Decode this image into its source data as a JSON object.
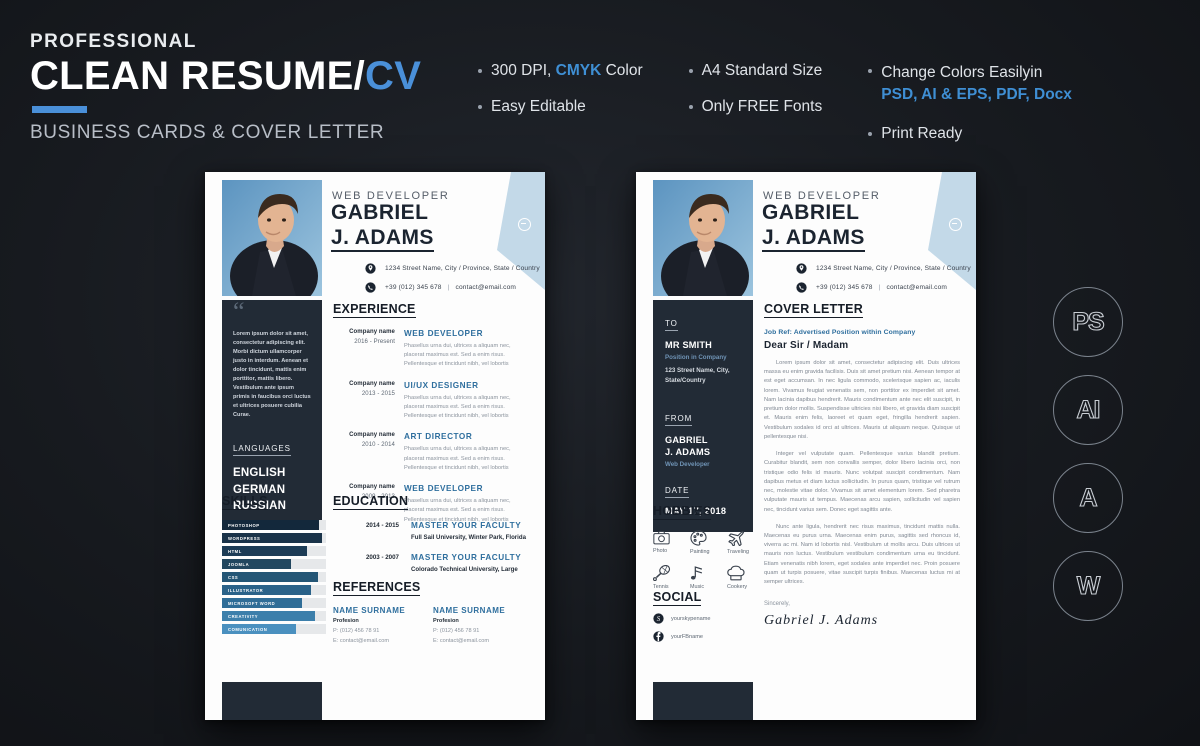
{
  "header": {
    "eyebrow": "PROFESSIONAL",
    "title_main": "CLEAN RESUME/",
    "title_accent": "CV",
    "subtitle": "BUSINESS CARDS & COVER LETTER"
  },
  "features": {
    "col1": [
      {
        "pre": "300 DPI, ",
        "strong": "CMYK",
        "post": " Color"
      },
      {
        "pre": "Easy Editable",
        "strong": "",
        "post": ""
      }
    ],
    "col2": [
      {
        "pre": "A4 Standard Size",
        "strong": "",
        "post": ""
      },
      {
        "pre": "Only FREE Fonts",
        "strong": "",
        "post": ""
      }
    ],
    "col3": [
      {
        "line1": "Change Colors Easilyin",
        "line2": "PSD, AI & EPS, PDF, Docx"
      },
      {
        "line1": "Print Ready",
        "line2": ""
      }
    ]
  },
  "colors": {
    "accent_blue": "#4a90d9",
    "dark_navy": "#222b36",
    "page_bg": "#fdfdfd",
    "light_blue": "#c3d9e8",
    "title_blue": "#2f6f9e"
  },
  "resume": {
    "role": "WEB DEVELOPER",
    "name_line1": "GABRIEL",
    "name_line2": "J. ADAMS",
    "address": "1234 Street Name, City / Province, State / Country",
    "phone": "+39 (012) 345 678",
    "email": "contact@email.com",
    "profile_text": "Lorem ipsum dolor sit amet, consectetur adipiscing elit. Morbi dictum ullamcorper justo in interdum. Aenean et dolor tincidunt, mattis enim porttitor, mattis libero. Vestibulum ante ipsum primis in faucibus orci luctus et ultrices posuere cubilia Curae.",
    "languages_heading": "LANGUAGES",
    "languages": [
      "ENGLISH",
      "GERMAN",
      "RUSSIAN"
    ],
    "experience_heading": "EXPERIENCE",
    "experience": [
      {
        "company": "Company name",
        "years": "2016 - Present",
        "title": "WEB DEVELOPER",
        "desc": "Phasellus urna dui, ultrices a aliquam nec, placerat maximus est. Sed a enim risus. Pellentesque et tincidunt nibh, vel lobortis"
      },
      {
        "company": "Company name",
        "years": "2013 - 2015",
        "title": "UI/UX DESIGNER",
        "desc": "Phasellus urna dui, ultrices a aliquam nec, placerat maximus est. Sed a enim risus. Pellentesque et tincidunt nibh, vel lobortis"
      },
      {
        "company": "Company name",
        "years": "2010 - 2014",
        "title": "ART DIRECTOR",
        "desc": "Phasellus urna dui, ultrices a aliquam nec, placerat maximus est. Sed a enim risus. Pellentesque et tincidunt nibh, vel lobortis"
      },
      {
        "company": "Company name",
        "years": "2009 - 2013",
        "title": "WEB DEVELOPER",
        "desc": "Phasellus urna dui, ultrices a aliquam nec, placerat maximus est. Sed a enim risus. Pellentesque et tincidunt nibh, vel lobortis"
      }
    ],
    "skills_heading": "SKILLS",
    "skills": [
      {
        "label": "PHOTOSHOP",
        "value": 93,
        "color": "#13283b"
      },
      {
        "label": "WORDPRESS",
        "value": 96,
        "color": "#1a3349"
      },
      {
        "label": "HTML",
        "value": 82,
        "color": "#1d3c56"
      },
      {
        "label": "JOOMLA",
        "value": 66,
        "color": "#22475f"
      },
      {
        "label": "CSS",
        "value": 92,
        "color": "#245676"
      },
      {
        "label": "ILLUSTRATOR",
        "value": 86,
        "color": "#2a6289"
      },
      {
        "label": "MICROSOFT WORD",
        "value": 77,
        "color": "#2f6d97"
      },
      {
        "label": "CREATIVITY",
        "value": 89,
        "color": "#3c7fab"
      },
      {
        "label": "COMUNICATION",
        "value": 71,
        "color": "#4a90bf"
      }
    ],
    "education_heading": "EDUCATION",
    "education": [
      {
        "years": "2014 - 2015",
        "title": "MASTER YOUR FACULTY",
        "school": "Full Sail University, Winter Park, Florida"
      },
      {
        "years": "2003 - 2007",
        "title": "MASTER YOUR FACULTY",
        "school": "Colorado Technical University, Large"
      }
    ],
    "references_heading": "REFERENCES",
    "references": [
      {
        "name": "NAME SURNAME",
        "profession": "Profesion",
        "phone": "P: (012) 456 78 91",
        "email": "E: contact@email.com"
      },
      {
        "name": "NAME SURNAME",
        "profession": "Profesion",
        "phone": "P: (012) 456 78 91",
        "email": "E: contact@email.com"
      }
    ]
  },
  "cover": {
    "to_heading": "TO",
    "to_name": "MR SMITH",
    "to_role": "Position in Company",
    "to_address": "123 Street Name, City, State/Country",
    "from_heading": "FROM",
    "from_name_1": "GABRIEL",
    "from_name_2": "J. ADAMS",
    "from_role": "Web Developer",
    "date_heading": "DATE",
    "date_value": "MAY 17, 2018",
    "heading": "COVER LETTER",
    "job_ref": "Job Ref: Advertised Position within Company",
    "salutation": "Dear Sir / Madam",
    "paragraphs": [
      "Lorem ipsum dolor sit amet, consectetur adipiscing elit. Duis ultrices massa eu enim gravida facilisis. Duis sit amet pretium nisi. Aenean tempor at est eget accumsan. In nec ligula commodo, scelerisque sapien ac, iaculis lorem. Vivamus feugiat venenatis sem, non porttitor ex imperdiet sit amet. Nam lacinia dapibus hendrerit. Mauris condimentum ante nec elit suscipit, in pretium dolor mollis. Suspendisse ultricies nisi libero, et gravida diam suscipit et. Mauris enim felis, laoreet et quam eget, fringilla hendrerit sapien. Vestibulum sodales id orci at ultrices. Mauris ut aliquam neque. Quisque ut pellentesque nisi.",
      "Integer vel vulputate quam. Pellentesque varius blandit pretium. Curabitur blandit, sem non convallis semper, dolor libero lacinia orci, non tristique odio felis id mauris. Nunc volutpat suscipit condimentum. Nam dapibus metus et diam luctus sollicitudin. In purus quam, tristique vel rutrum nec, molestie vitae dolor. Vivamus sit amet elementum lorem. Sed pharetra vulputate mauris ut tempus. Maecenas arcu sapien, sollicitudin vel sapien nec, tincidunt varius sem. Donec eget sagittis ante.",
      "Nunc ante ligula, hendrerit nec risus maximus, tincidunt mattis nulla. Maecenas eu purus urna. Maecenas enim purus, sagittis sed rhoncus id, viverra ac mi. Nam id lobortis nisl. Vestibulum ut mollis arcu. Duis ultrices ut mauris non luctus. Vestibulum vestibulum condimentum urna eu tincidunt. Etiam venenatis nibh lorem, eget sodales ante imperdiet nec. Proin posuere quam ut turpis posuere, vitae suscipit turpis finibus. Maecenas luctus mi at semper ultrices."
    ],
    "closing": "Sincerely,",
    "signature": "Gabriel J. Adams",
    "hobbies_heading": "HOBBIES",
    "hobbies": [
      {
        "icon": "camera-icon",
        "label": "Photo"
      },
      {
        "icon": "palette-icon",
        "label": "Painting"
      },
      {
        "icon": "airplane-icon",
        "label": "Traveling"
      },
      {
        "icon": "racket-icon",
        "label": "Tennis"
      },
      {
        "icon": "music-note-icon",
        "label": "Music"
      },
      {
        "icon": "chef-hat-icon",
        "label": "Cookery"
      }
    ],
    "social_heading": "SOCIAL",
    "social": [
      {
        "icon": "skype-icon",
        "handle": "yourskypename"
      },
      {
        "icon": "facebook-icon",
        "handle": "yourFBname"
      }
    ]
  },
  "badges": [
    {
      "label": "PS",
      "name": "photoshop-badge"
    },
    {
      "label": "AI",
      "name": "illustrator-badge"
    },
    {
      "label": "A",
      "name": "indesign-badge"
    },
    {
      "label": "W",
      "name": "word-badge"
    }
  ]
}
